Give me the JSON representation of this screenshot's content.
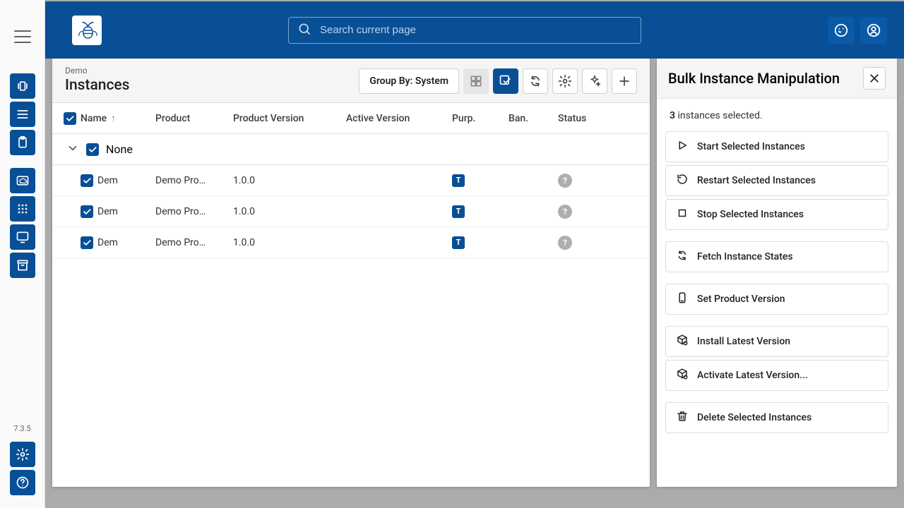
{
  "app": {
    "version": "7.3.5"
  },
  "search": {
    "placeholder": "Search current page"
  },
  "page": {
    "breadcrumb": "Demo",
    "title": "Instances"
  },
  "toolbar": {
    "group_by_label": "Group By: System"
  },
  "table": {
    "columns": {
      "name": "Name",
      "product": "Product",
      "product_version": "Product Version",
      "active_version": "Active Version",
      "purp": "Purp.",
      "ban": "Ban.",
      "status": "Status"
    },
    "group_label": "None",
    "purp_badge": "T",
    "status_badge": "?",
    "rows": [
      {
        "name": "Dem",
        "product": "Demo Pro…",
        "product_version": "1.0.0",
        "active_version": ""
      },
      {
        "name": "Dem",
        "product": "Demo Pro…",
        "product_version": "1.0.0",
        "active_version": ""
      },
      {
        "name": "Dem",
        "product": "Demo Pro…",
        "product_version": "1.0.0",
        "active_version": ""
      }
    ]
  },
  "panel": {
    "title": "Bulk Instance Manipulation",
    "selected_count": "3",
    "selected_suffix": " instances selected.",
    "actions": {
      "start": "Start Selected Instances",
      "restart": "Restart Selected Instances",
      "stop": "Stop Selected Instances",
      "fetch": "Fetch Instance States",
      "setver": "Set Product Version",
      "install": "Install Latest Version",
      "activate": "Activate Latest Version...",
      "delete": "Delete Selected Instances"
    }
  }
}
